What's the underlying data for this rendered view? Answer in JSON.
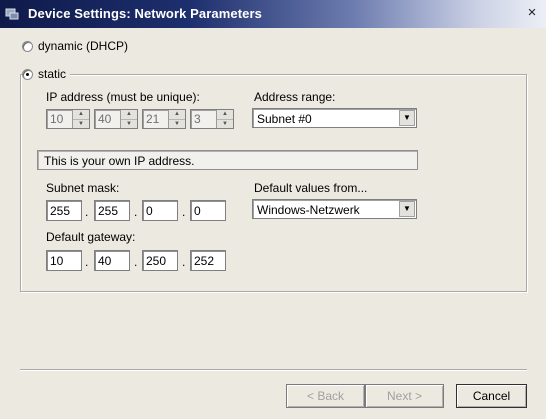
{
  "window": {
    "title": "Device Settings: Network Parameters",
    "close_symbol": "×",
    "icon": "network-device-icon"
  },
  "mode": {
    "dynamic_label": "dynamic (DHCP)",
    "static_label": "static",
    "selected": "static"
  },
  "ip": {
    "label": "IP address (must be unique):",
    "octets": [
      "10",
      "40",
      "21",
      "3"
    ],
    "info": "This is your own IP address."
  },
  "address_range": {
    "label": "Address range:",
    "value": "Subnet #0"
  },
  "subnet": {
    "label": "Subnet mask:",
    "octets": [
      "255",
      "255",
      "0",
      "0"
    ]
  },
  "defaults": {
    "label": "Default values from...",
    "value": "Windows-Netzwerk"
  },
  "gateway": {
    "label": "Default gateway:",
    "octets": [
      "10",
      "40",
      "250",
      "252"
    ]
  },
  "buttons": {
    "back": "< Back",
    "next": "Next >",
    "cancel": "Cancel"
  },
  "symbols": {
    "spin_up": "▲",
    "spin_down": "▼",
    "dropdown": "▼",
    "dot": "."
  }
}
